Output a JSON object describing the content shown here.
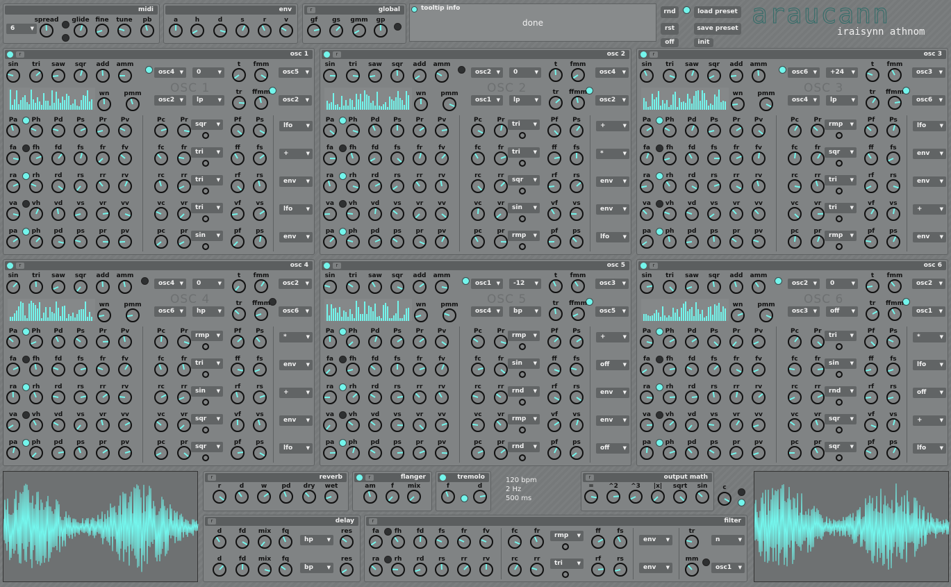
{
  "brand": {
    "title": "araucann",
    "subtitle": "iraisynn athnom"
  },
  "midi": {
    "title": "midi",
    "voices": "6",
    "labels": [
      "spread",
      "glide",
      "fine",
      "tune",
      "pb"
    ]
  },
  "env": {
    "title": "env",
    "labels": [
      "a",
      "h",
      "d",
      "s",
      "r",
      "v"
    ]
  },
  "global": {
    "title": "global",
    "labels": [
      "gf",
      "gs",
      "gmm",
      "gp"
    ]
  },
  "tooltip": {
    "title": "tooltip info",
    "text": "done"
  },
  "buttons": {
    "rnd": "rnd",
    "rst": "rst",
    "off": "off",
    "load": "load preset",
    "save": "save preset",
    "init": "init"
  },
  "osc_common": {
    "wave_labels": [
      "sin",
      "tri",
      "saw",
      "sqr",
      "add",
      "amm"
    ],
    "t_label": "t",
    "fmm_label": "fmm",
    "wn_label": "wn",
    "pmm_label": "pmm",
    "tr_label": "tr",
    "ffmm_label": "ffmm",
    "rows": [
      [
        "Pa",
        "Ph",
        "Pd",
        "Ps",
        "Pr",
        "Pv",
        "Pc",
        "Pr",
        "Pf",
        "Ps"
      ],
      [
        "fa",
        "fh",
        "fd",
        "fs",
        "fr",
        "fv",
        "fc",
        "fr",
        "ff",
        "fs"
      ],
      [
        "ra",
        "rh",
        "rd",
        "rs",
        "rr",
        "rv",
        "rc",
        "rr",
        "rf",
        "rs"
      ],
      [
        "va",
        "vh",
        "vd",
        "vs",
        "vr",
        "vv",
        "vc",
        "vr",
        "vf",
        "vs"
      ],
      [
        "pa",
        "ph",
        "pd",
        "ps",
        "pr",
        "pv",
        "pc",
        "pr",
        "pf",
        "ps"
      ]
    ],
    "r_btn": "r"
  },
  "oscs": [
    {
      "title": "osc 1",
      "tag": "OSC 1",
      "src1": "osc4",
      "semi": "0",
      "fm": "osc5",
      "src2": "osc2",
      "ftype": "lp",
      "ffm": "osc2",
      "mods": [
        "sqr",
        "tri",
        "tri",
        "tri",
        "sin"
      ],
      "dest": [
        "lfo",
        "+",
        "env",
        "lfo",
        "env"
      ]
    },
    {
      "title": "osc 2",
      "tag": "OSC 2",
      "src1": "osc2",
      "semi": "0",
      "fm": "osc4",
      "src2": "osc1",
      "ftype": "lp",
      "ffm": "osc2",
      "mods": [
        "tri",
        "tri",
        "sqr",
        "sin",
        "rmp"
      ],
      "dest": [
        "+",
        "*",
        "env",
        "env",
        "lfo"
      ]
    },
    {
      "title": "osc 3",
      "tag": "OSC 3",
      "src1": "osc6",
      "semi": "+24",
      "fm": "osc3",
      "src2": "osc4",
      "ftype": "lp",
      "ffm": "osc6",
      "mods": [
        "rmp",
        "sqr",
        "tri",
        "tri",
        "rmp"
      ],
      "dest": [
        "lfo",
        "env",
        "env",
        "+",
        "env"
      ]
    },
    {
      "title": "osc 4",
      "tag": "OSC 4",
      "src1": "osc4",
      "semi": "0",
      "fm": "osc2",
      "src2": "osc6",
      "ftype": "hp",
      "ffm": "osc6",
      "mods": [
        "rmp",
        "tri",
        "sin",
        "sqr",
        "sqr"
      ],
      "dest": [
        "*",
        "env",
        "+",
        "env",
        "lfo"
      ]
    },
    {
      "title": "osc 5",
      "tag": "OSC 5",
      "src1": "osc1",
      "semi": "-12",
      "fm": "osc3",
      "src2": "osc4",
      "ftype": "bp",
      "ffm": "osc5",
      "mods": [
        "rmp",
        "sin",
        "rnd",
        "rmp",
        "rnd"
      ],
      "dest": [
        "+",
        "off",
        "env",
        "env",
        "off"
      ]
    },
    {
      "title": "osc 6",
      "tag": "OSC 6",
      "src1": "osc2",
      "semi": "0",
      "fm": "osc2",
      "src2": "osc3",
      "ftype": "off",
      "ffm": "osc1",
      "mods": [
        "tri",
        "sin",
        "rnd",
        "sqr",
        "sqr"
      ],
      "dest": [
        "*",
        "lfo",
        "off",
        "+",
        "lfo"
      ]
    }
  ],
  "reverb": {
    "title": "reverb",
    "labels": [
      "r",
      "d",
      "w",
      "pd",
      "dry",
      "wet"
    ]
  },
  "flanger": {
    "title": "flanger",
    "labels": [
      "am",
      "f",
      "mix"
    ]
  },
  "tremolo": {
    "title": "tremolo",
    "labels": [
      "f",
      "d"
    ]
  },
  "tempo": {
    "bpm": "120 bpm",
    "hz": "2 Hz",
    "ms": "500 ms"
  },
  "outmath": {
    "title": "output math",
    "labels": [
      "=",
      "^2",
      "^3",
      "|x|",
      "sqrt",
      "sin",
      "c"
    ]
  },
  "delay": {
    "title": "delay",
    "labels": [
      "d",
      "fd",
      "mix",
      "fq",
      "res"
    ],
    "f1": "hp",
    "f2": "bp"
  },
  "filter": {
    "title": "filter",
    "row1": [
      "fa",
      "fh",
      "fd",
      "fs",
      "fr",
      "fv",
      "fc",
      "fr",
      "ff",
      "fs",
      "tr"
    ],
    "row2": [
      "ra",
      "rh",
      "rd",
      "rs",
      "rr",
      "rv",
      "rc",
      "rr",
      "rf",
      "rs",
      "mm"
    ],
    "m1": "rmp",
    "m2": "tri",
    "d1": "env",
    "d2": "env",
    "t1": "n",
    "t2": "osc1"
  },
  "colors": {
    "accent": "#73f5ec",
    "panel": "#808384",
    "header": "#5b5e5f"
  }
}
